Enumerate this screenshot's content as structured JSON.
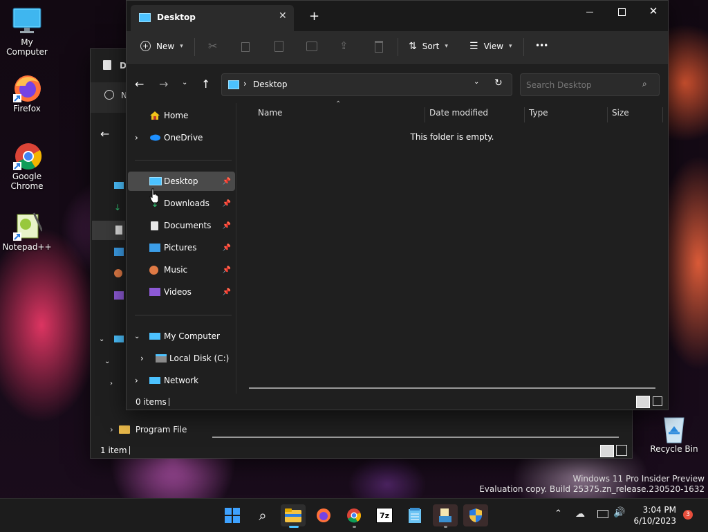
{
  "desktop": {
    "icons": [
      {
        "label": "My Computer",
        "icon": "monitor-icon"
      },
      {
        "label": "Firefox",
        "icon": "firefox-icon"
      },
      {
        "label": "Google Chrome",
        "icon": "chrome-icon"
      },
      {
        "label": "Notepad++",
        "icon": "notepadpp-icon"
      },
      {
        "label": "Recycle Bin",
        "icon": "recycle-bin-icon"
      }
    ],
    "watermark_line1": "Windows 11 Pro Insider Preview",
    "watermark_line2": "Evaluation copy. Build 25375.zn_release.230520-1632"
  },
  "back_window": {
    "title_fragment": "D",
    "new_fragment": "N",
    "tree": [
      {
        "label": "Program File"
      }
    ],
    "status": "1 item"
  },
  "explorer": {
    "tab_title": "Desktop",
    "new_tab": "+",
    "toolbar": {
      "new_label": "New",
      "sort_label": "Sort",
      "view_label": "View",
      "more_label": "•••"
    },
    "address": {
      "breadcrumb": "Desktop"
    },
    "search": {
      "placeholder": "Search Desktop"
    },
    "nav": {
      "home": "Home",
      "onedrive": "OneDrive",
      "quick_access": [
        {
          "label": "Desktop",
          "icon": "desktop-folder-icon"
        },
        {
          "label": "Downloads",
          "icon": "download-icon"
        },
        {
          "label": "Documents",
          "icon": "document-icon"
        },
        {
          "label": "Pictures",
          "icon": "pictures-icon"
        },
        {
          "label": "Music",
          "icon": "music-icon"
        },
        {
          "label": "Videos",
          "icon": "videos-icon"
        }
      ],
      "my_computer": "My Computer",
      "local_disk": "Local Disk (C:)",
      "network": "Network"
    },
    "columns": [
      "Name",
      "Date modified",
      "Type",
      "Size"
    ],
    "empty_message": "This folder is empty.",
    "status": "0 items"
  },
  "taskbar": {
    "time": "3:04 PM",
    "date": "6/10/2023",
    "notification_count": "3"
  },
  "colors": {
    "accent": "#4cc2ff",
    "window_bg": "#1f1f1f",
    "selected": "#3d3d3d",
    "badge": "#e84e3c"
  }
}
